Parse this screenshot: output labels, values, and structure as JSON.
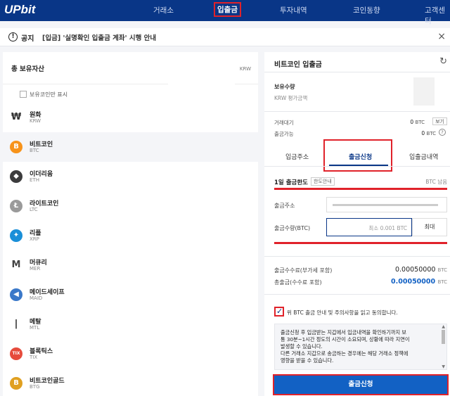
{
  "topnav": {
    "logo": "UPbit",
    "items": [
      "거래소",
      "입출금",
      "투자내역",
      "코인동향",
      "고객센터"
    ],
    "active_index": 1
  },
  "notice": {
    "label": "공지",
    "text": "[입금] '실명확인 입출금 계좌' 시행 안내",
    "close": "×"
  },
  "left": {
    "title": "총 보유자산",
    "currency": "KRW",
    "filter_label": "보유코인만 표시",
    "coins": [
      {
        "name": "원화",
        "ticker": "KRW",
        "icon": "won-icon",
        "symbol": "₩",
        "color": "#333333"
      },
      {
        "name": "비트코인",
        "ticker": "BTC",
        "icon": "bitcoin-icon",
        "symbol": "B",
        "color": "#f7931a"
      },
      {
        "name": "이더리움",
        "ticker": "ETH",
        "icon": "ethereum-icon",
        "symbol": "◆",
        "color": "#3c3c3d"
      },
      {
        "name": "라이트코인",
        "ticker": "LTC",
        "icon": "litecoin-icon",
        "symbol": "Ł",
        "color": "#9a9a9a"
      },
      {
        "name": "리플",
        "ticker": "XRP",
        "icon": "ripple-icon",
        "symbol": "✦",
        "color": "#1a8fd8"
      },
      {
        "name": "머큐리",
        "ticker": "MER",
        "icon": "mercury-icon",
        "symbol": "M",
        "color": "#444444"
      },
      {
        "name": "메이드세이프",
        "ticker": "MAID",
        "icon": "maidsafe-icon",
        "symbol": "◀",
        "color": "#3a78c9"
      },
      {
        "name": "메탈",
        "ticker": "MTL",
        "icon": "metal-icon",
        "symbol": "|",
        "color": "#222222"
      },
      {
        "name": "블록틱스",
        "ticker": "TIX",
        "icon": "blocktix-icon",
        "symbol": "TIX",
        "color": "#e64b3c"
      },
      {
        "name": "비트코인골드",
        "ticker": "BTG",
        "icon": "bitcoin-gold-icon",
        "symbol": "B",
        "color": "#e0a020"
      }
    ],
    "selected_index": 1
  },
  "right": {
    "title": "비트코인 입출금",
    "hold_label": "보유수량",
    "hold_sub": "KRW 평가금액",
    "pending_label": "거래대기",
    "pending_value": "0",
    "pending_unit": "BTC",
    "view_btn": "보기",
    "available_label": "출금가능",
    "available_value": "0",
    "available_unit": "BTC",
    "tabs": [
      "입금주소",
      "출금신청",
      "입출금내역"
    ],
    "active_tab": 1,
    "limit_label": "1일 출금한도",
    "limit_btn": "한도안내",
    "limit_suffix": "BTC 남음",
    "addr_label": "출금주소",
    "amount_label": "출금수량(BTC)",
    "amount_placeholder": "최소 0.001 BTC",
    "max_btn": "최대",
    "fee_label": "출금수수료(부가세 포함)",
    "fee_value": "0.00050000",
    "total_label": "총출금(수수료 포함)",
    "total_value": "0.00050000",
    "unit": "BTC",
    "agree_text": "위 BTC 출금 안내 및 주의사항을 읽고 동의합니다.",
    "terms": [
      "출금신청 후 입금받는 지갑에서 입금내역을 확인하기까지 보",
      "통 30분~1시간 정도의 시간이 소요되며, 상황에 따라 지연이",
      "발생할 수 있습니다.",
      "다른 거래소 지갑으로 송금하는 경우에는 해당 거래소 정책에",
      "영향을 받을 수 있습니다."
    ],
    "submit": "출금신청"
  },
  "colors": {
    "nav_bg": "#093687",
    "highlight": "#e0222a",
    "primary": "#1261c4"
  }
}
